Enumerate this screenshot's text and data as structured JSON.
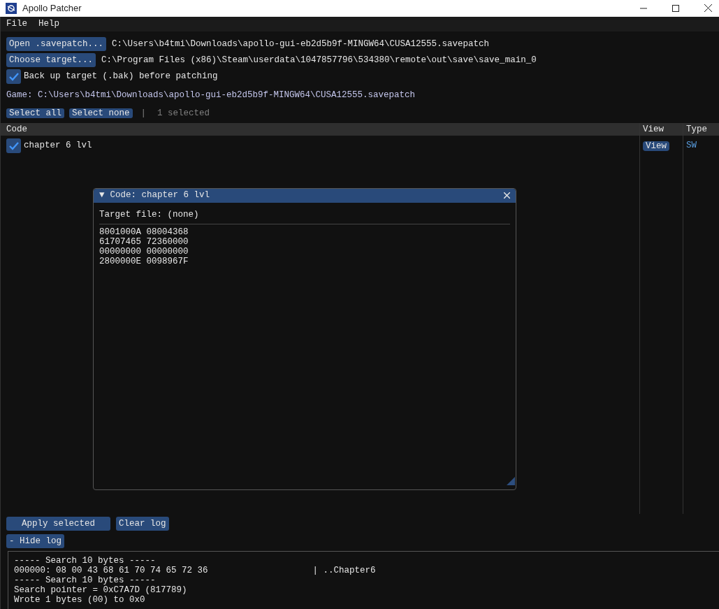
{
  "window": {
    "title": "Apollo Patcher"
  },
  "menu": [
    {
      "label": "File"
    },
    {
      "label": "Help"
    }
  ],
  "file_rows": [
    {
      "button": "Open .savepatch...",
      "path": "C:\\Users\\b4tmi\\Downloads\\apollo-gui-eb2d5b9f-MINGW64\\CUSA12555.savepatch"
    },
    {
      "button": "Choose target...",
      "path": "C:\\Program Files (x86)\\Steam\\userdata\\1047857796\\534380\\remote\\out\\save\\save_main_0"
    }
  ],
  "backup": {
    "label": "Back up target (.bak) before patching",
    "checked": true
  },
  "game_line": "Game: C:\\Users\\b4tmi\\Downloads\\apollo-gui-eb2d5b9f-MINGW64\\CUSA12555.savepatch",
  "selection": {
    "select_all": "Select all",
    "select_none": "Select none",
    "separator": "|",
    "count": "1 selected"
  },
  "table": {
    "columns": [
      "Code",
      "View",
      "Type"
    ],
    "rows": [
      {
        "name": "chapter 6 lvl",
        "checked": true,
        "view": "View",
        "type": "SW"
      }
    ]
  },
  "code_window": {
    "collapse_glyph": "▼",
    "title": "Code: chapter 6 lvl",
    "target_file": "Target file: (none)",
    "lines": [
      "8001000A 08004368",
      "61707465 72360000",
      "00000000 00000000",
      "2800000E 0098967F"
    ]
  },
  "actions": {
    "apply": "Apply selected",
    "clear": "Clear log",
    "hide_log": "- Hide log"
  },
  "log_lines": [
    "----- Search 10 bytes -----",
    "000000: 08 00 43 68 61 70 74 65 72 36                    | ..Chapter6",
    "----- Search 10 bytes -----",
    "Search pointer = 0xC7A7D (817789)",
    "Wrote 1 bytes (00) to 0x0"
  ]
}
